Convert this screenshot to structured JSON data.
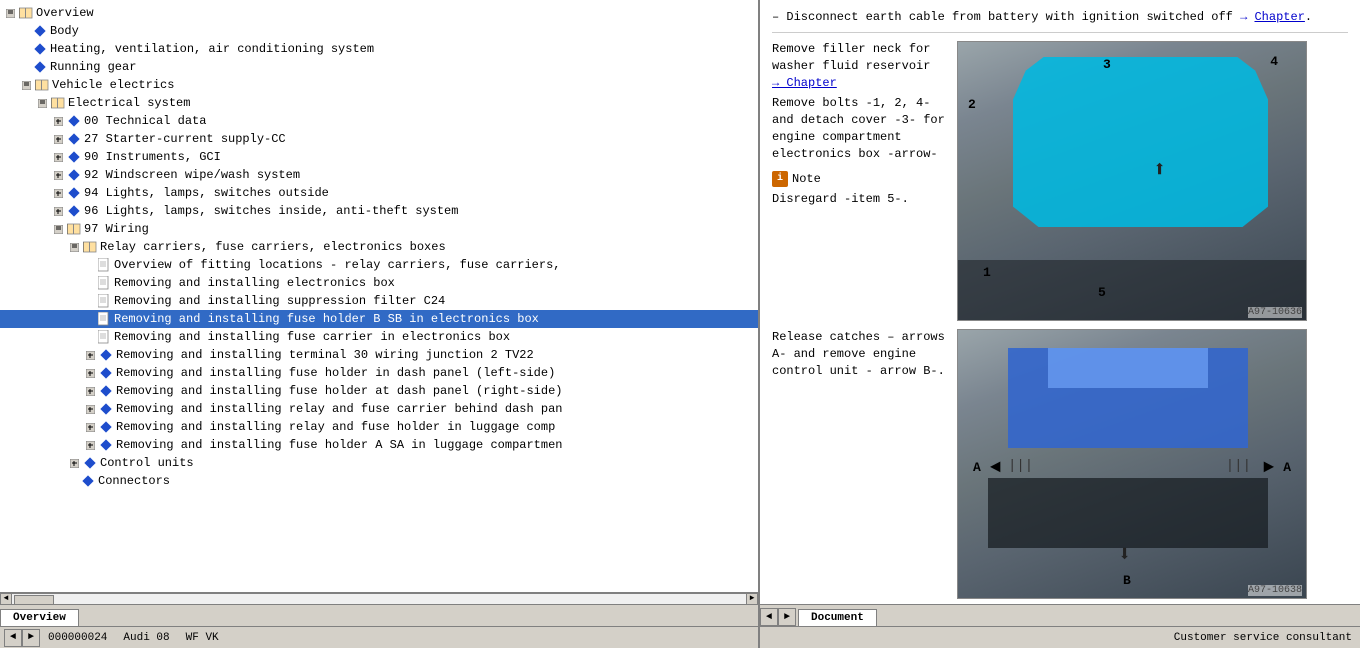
{
  "left_panel": {
    "tree_items": [
      {
        "id": "overview",
        "indent": 0,
        "type": "book",
        "expand": "▼",
        "label": "Overview",
        "selected": false
      },
      {
        "id": "body",
        "indent": 1,
        "type": "diamond",
        "expand": "",
        "label": "Body",
        "selected": false
      },
      {
        "id": "hvac",
        "indent": 1,
        "type": "diamond",
        "expand": "",
        "label": "Heating, ventilation, air conditioning system",
        "selected": false
      },
      {
        "id": "running",
        "indent": 1,
        "type": "diamond",
        "expand": "",
        "label": "Running gear",
        "selected": false
      },
      {
        "id": "vehicle-elec",
        "indent": 1,
        "type": "book",
        "expand": "▼",
        "label": "Vehicle electrics",
        "selected": false
      },
      {
        "id": "elec-sys",
        "indent": 2,
        "type": "book",
        "expand": "▼",
        "label": "Electrical system",
        "selected": false
      },
      {
        "id": "00-tech",
        "indent": 3,
        "type": "diamond",
        "expand": "+",
        "label": "00 Technical data",
        "selected": false
      },
      {
        "id": "27-starter",
        "indent": 3,
        "type": "diamond",
        "expand": "+",
        "label": "27 Starter-current supply-CC",
        "selected": false
      },
      {
        "id": "90-inst",
        "indent": 3,
        "type": "diamond",
        "expand": "+",
        "label": "90 Instruments, GCI",
        "selected": false
      },
      {
        "id": "92-wiper",
        "indent": 3,
        "type": "diamond",
        "expand": "+",
        "label": "92 Windscreen wipe/wash system",
        "selected": false
      },
      {
        "id": "94-lights",
        "indent": 3,
        "type": "diamond",
        "expand": "+",
        "label": "94 Lights, lamps, switches outside",
        "selected": false
      },
      {
        "id": "96-lights",
        "indent": 3,
        "type": "diamond",
        "expand": "+",
        "label": "96 Lights, lamps, switches inside, anti-theft system",
        "selected": false
      },
      {
        "id": "97-wiring",
        "indent": 3,
        "type": "book",
        "expand": "▼",
        "label": "97 Wiring",
        "selected": false
      },
      {
        "id": "relay",
        "indent": 4,
        "type": "book",
        "expand": "▼",
        "label": "Relay carriers, fuse carriers, electronics boxes",
        "selected": false
      },
      {
        "id": "overview-fitting",
        "indent": 5,
        "type": "doc",
        "expand": "",
        "label": "Overview of fitting locations - relay carriers, fuse carriers,",
        "selected": false
      },
      {
        "id": "rem-elec-box",
        "indent": 5,
        "type": "doc",
        "expand": "",
        "label": "Removing and installing electronics box",
        "selected": false
      },
      {
        "id": "rem-suppress",
        "indent": 5,
        "type": "doc",
        "expand": "",
        "label": "Removing and installing suppression filter C24",
        "selected": false
      },
      {
        "id": "rem-fuse-sb",
        "indent": 5,
        "type": "doc",
        "expand": "",
        "label": "Removing and installing fuse holder B SB in electronics box",
        "selected": true
      },
      {
        "id": "rem-fuse-carrier",
        "indent": 5,
        "type": "doc",
        "expand": "",
        "label": "Removing and installing fuse carrier in electronics box",
        "selected": false
      },
      {
        "id": "rem-terminal30",
        "indent": 5,
        "type": "diamond",
        "expand": "+",
        "label": "Removing and installing terminal 30 wiring junction 2 TV22",
        "selected": false
      },
      {
        "id": "rem-fuse-dash-l",
        "indent": 5,
        "type": "diamond",
        "expand": "+",
        "label": "Removing and installing fuse holder in dash panel (left-side)",
        "selected": false
      },
      {
        "id": "rem-fuse-dash-r",
        "indent": 5,
        "type": "diamond",
        "expand": "+",
        "label": "Removing and installing fuse holder at dash panel (right-side)",
        "selected": false
      },
      {
        "id": "rem-relay-dash",
        "indent": 5,
        "type": "diamond",
        "expand": "+",
        "label": "Removing and installing relay and fuse carrier behind dash pan",
        "selected": false
      },
      {
        "id": "rem-relay-lug",
        "indent": 5,
        "type": "diamond",
        "expand": "+",
        "label": "Removing and installing relay and fuse holder in luggage comp",
        "selected": false
      },
      {
        "id": "rem-fuse-sa",
        "indent": 5,
        "type": "diamond",
        "expand": "+",
        "label": "Removing and installing fuse holder A SA in luggage compartmen",
        "selected": false
      },
      {
        "id": "control-units",
        "indent": 4,
        "type": "diamond",
        "expand": "+",
        "label": "Control units",
        "selected": false
      },
      {
        "id": "connectors",
        "indent": 4,
        "type": "diamond",
        "expand": "",
        "label": "Connectors",
        "selected": false
      }
    ],
    "tab_label": "Overview"
  },
  "right_panel": {
    "tab_label": "Document",
    "instruction_1": "– Disconnect earth cable from battery with ignition switched off",
    "chapter_link": "→ Chapter",
    "instruction_2_title": "Remove filler neck for washer fluid reservoir",
    "instruction_2_link": "→ Chapter",
    "instruction_3": "Remove bolts -1, 2, 4- and detach cover -3- for engine compartment electronics box -arrow-",
    "note_label": "Note",
    "note_text": "Disregard -item 5-.",
    "image1_caption": "A97-10636",
    "image1_labels": [
      "1",
      "2",
      "3",
      "4",
      "5"
    ],
    "instruction_4": "Release catches – arrows A- and remove engine control unit - arrow B-.",
    "image2_caption": "A97-10638",
    "image2_labels": [
      "A",
      "A",
      "B"
    ],
    "status_text": "Customer service consultant"
  },
  "status_bar": {
    "code": "000000024",
    "model": "Audi 08",
    "spec": "WF VK"
  }
}
